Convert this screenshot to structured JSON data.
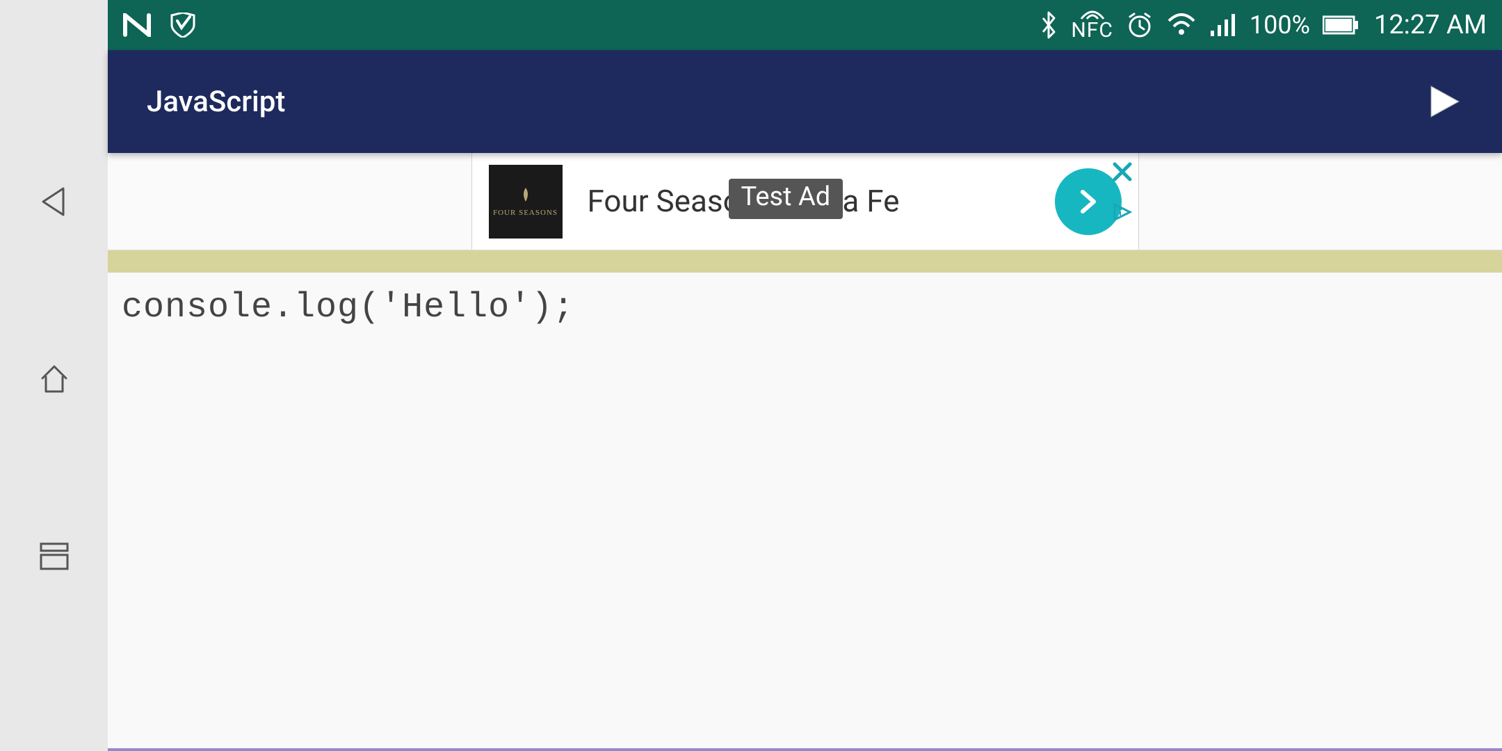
{
  "status": {
    "nfc_label": "NFC",
    "battery_pct": "100%",
    "time": "12:27 AM"
  },
  "app": {
    "title": "JavaScript"
  },
  "ad": {
    "logo_text": "FOUR SEASONS",
    "headline": "Four Seasons Santa Fe",
    "overlay_label": "Test Ad"
  },
  "editor": {
    "code": "console.log('Hello');"
  }
}
